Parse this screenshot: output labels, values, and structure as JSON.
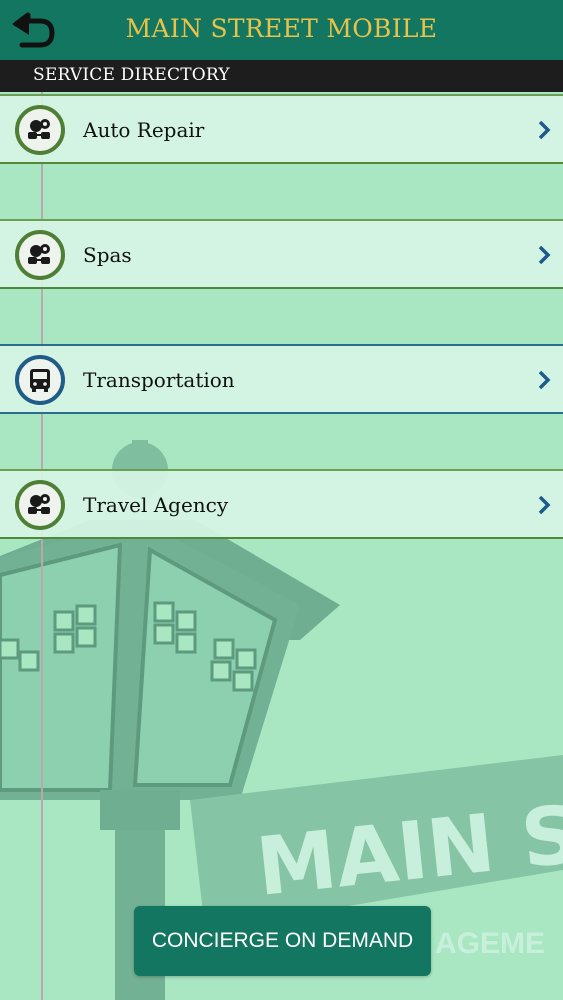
{
  "header": {
    "title": "MAIN STREET MOBILE",
    "back_icon": "back-arrow-icon"
  },
  "subheader": {
    "title": "SERVICE DIRECTORY"
  },
  "directory": {
    "items": [
      {
        "label": "Auto Repair",
        "icon": "services-icon"
      },
      {
        "label": "Spas",
        "icon": "services-icon"
      },
      {
        "label": "Transportation",
        "icon": "bus-icon"
      },
      {
        "label": "Travel Agency",
        "icon": "services-icon"
      }
    ]
  },
  "background": {
    "sign_text": "MAIN ST",
    "partial_text": "AGEME"
  },
  "cta": {
    "label": "CONCIERGE ON DEMAND"
  },
  "colors": {
    "primary": "#137660",
    "title_gold": "#e8c24a",
    "background": "#a9e6c2",
    "chevron": "#1d5b8c"
  }
}
